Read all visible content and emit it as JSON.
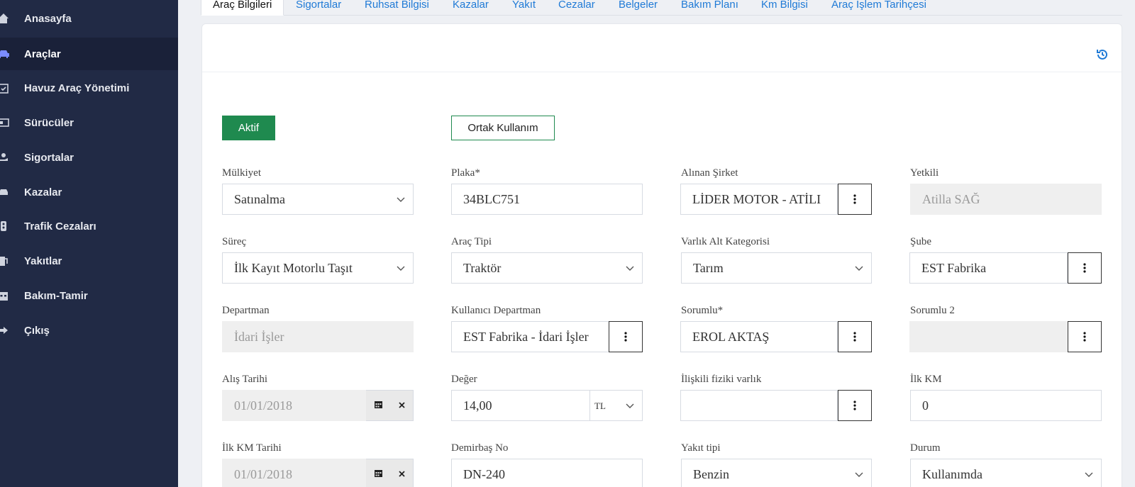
{
  "sidebar": {
    "items": [
      {
        "label": "Anasayfa",
        "icon": "home-icon",
        "active": false
      },
      {
        "label": "Araçlar",
        "icon": "car-icon",
        "active": true
      },
      {
        "label": "Havuz Araç Yönetimi",
        "icon": "calendar-check-icon",
        "active": false
      },
      {
        "label": "Sürücüler",
        "icon": "id-card-icon",
        "active": false
      },
      {
        "label": "Sigortalar",
        "icon": "hand-money-icon",
        "active": false
      },
      {
        "label": "Kazalar",
        "icon": "car-crash-icon",
        "active": false
      },
      {
        "label": "Trafik Cezaları",
        "icon": "traffic-light-icon",
        "active": false
      },
      {
        "label": "Yakıtlar",
        "icon": "gas-pump-icon",
        "active": false
      },
      {
        "label": "Bakım-Tamir",
        "icon": "calendar-icon",
        "active": false
      },
      {
        "label": "Çıkış",
        "icon": "sign-out-icon",
        "active": false
      }
    ]
  },
  "tabs": [
    {
      "label": "Araç Bilgileri",
      "active": true
    },
    {
      "label": "Sigortalar"
    },
    {
      "label": "Ruhsat Bilgisi"
    },
    {
      "label": "Kazalar"
    },
    {
      "label": "Yakıt"
    },
    {
      "label": "Cezalar"
    },
    {
      "label": "Belgeler"
    },
    {
      "label": "Bakım Planı"
    },
    {
      "label": "Km Bilgisi"
    },
    {
      "label": "Araç İşlem Tarihçesi"
    }
  ],
  "buttons": {
    "aktif": "Aktif",
    "ortak": "Ortak Kullanım"
  },
  "form": {
    "mulkiyet": {
      "label": "Mülkiyet",
      "value": "Satınalma"
    },
    "plaka": {
      "label": "Plaka*",
      "value": "34BLC751"
    },
    "alinan_sirket": {
      "label": "Alınan Şirket",
      "value": "LİDER MOTOR - ATİLI"
    },
    "yetkili": {
      "label": "Yetkili",
      "value": "Atilla SAĞ"
    },
    "surec": {
      "label": "Süreç",
      "value": "İlk Kayıt Motorlu Taşıt"
    },
    "arac_tipi": {
      "label": "Araç Tipi",
      "value": "Traktör"
    },
    "varlik_alt_kategorisi": {
      "label": "Varlık Alt Kategorisi",
      "value": "Tarım"
    },
    "sube": {
      "label": "Şube",
      "value": "EST Fabrika"
    },
    "departman": {
      "label": "Departman",
      "value": "İdari İşler"
    },
    "kullanici_departman": {
      "label": "Kullanıcı Departman",
      "value": "EST Fabrika - İdari İşler"
    },
    "sorumlu": {
      "label": "Sorumlu*",
      "value": "EROL AKTAŞ"
    },
    "sorumlu2": {
      "label": "Sorumlu 2",
      "value": ""
    },
    "alis_tarihi": {
      "label": "Alış Tarihi",
      "value": "01/01/2018"
    },
    "deger": {
      "label": "Değer",
      "value": "14,00",
      "currency": "TL"
    },
    "iliskili_fiziki_varlik": {
      "label": "İlişkili fiziki varlık",
      "value": ""
    },
    "ilk_km": {
      "label": "İlk KM",
      "value": "0"
    },
    "ilk_km_tarihi": {
      "label": "İlk KM Tarihi",
      "value": "01/01/2018"
    },
    "demirbas_no": {
      "label": "Demirbaş No",
      "value": "DN-240"
    },
    "yakit_tipi": {
      "label": "Yakıt tipi",
      "value": "Benzin"
    },
    "durum": {
      "label": "Durum",
      "value": "Kullanımda"
    }
  },
  "colors": {
    "sidebar_bg": "#212a45",
    "accent_green": "#1f8a4f",
    "link_blue": "#1f7ad6"
  }
}
